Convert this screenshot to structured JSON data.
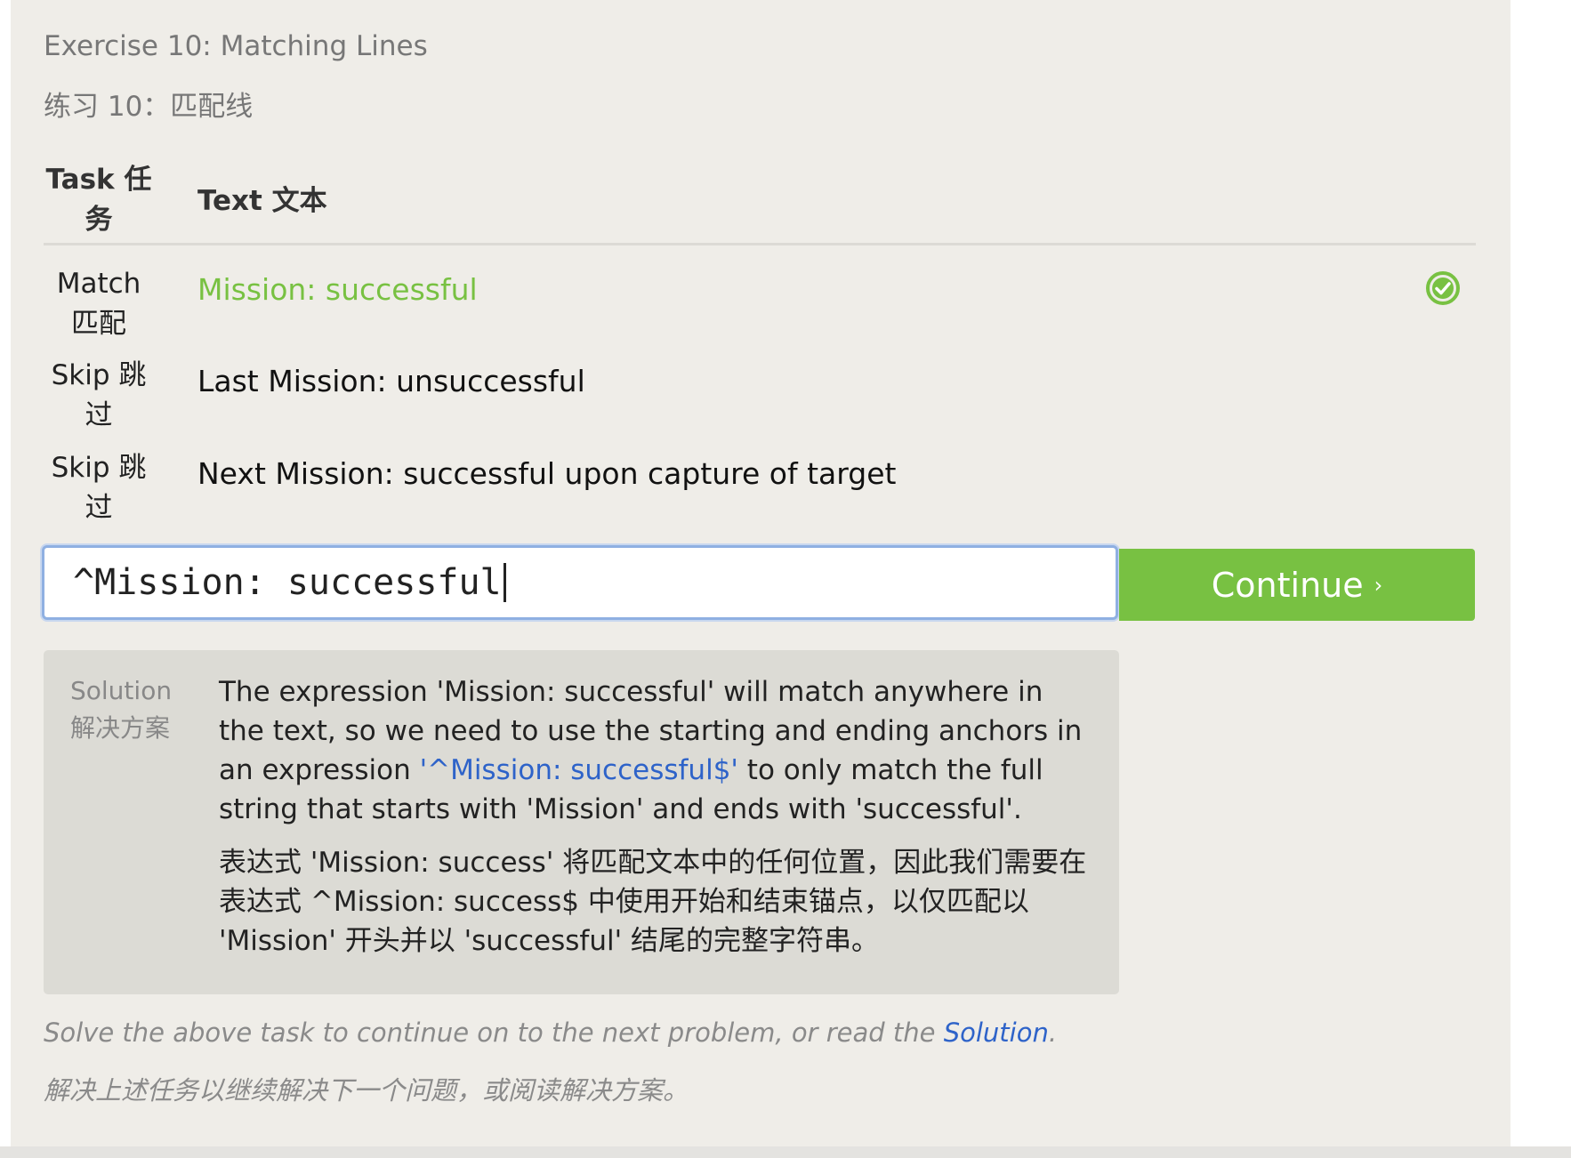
{
  "exercise": {
    "title_en": "Exercise 10: Matching Lines",
    "title_zh": "练习 10：匹配线"
  },
  "table": {
    "header_task": "Task 任务",
    "header_text": "Text 文本",
    "rows": [
      {
        "task": "Match 匹配",
        "text": "Mission: successful",
        "status": "matched"
      },
      {
        "task": "Skip 跳过",
        "text": "Last Mission: unsuccessful",
        "status": ""
      },
      {
        "task": "Skip 跳过",
        "text": "Next Mission: successful upon capture of target",
        "status": ""
      }
    ]
  },
  "input": {
    "value": "^Mission: successful"
  },
  "continue_button": {
    "label": "Continue",
    "chevron": "›"
  },
  "solution": {
    "label": "Solution 解决方案",
    "en_part1": "The expression 'Mission: successful' will match anywhere in the text, so we need to use the starting and ending anchors in an expression ",
    "en_highlight": "'^Mission: successful$'",
    "en_part2": " to only match the full string that starts with 'Mission' and ends with 'successful'.",
    "zh": "表达式 'Mission: success' 将匹配文本中的任何位置，因此我们需要在表达式 ^Mission: success$ 中使用开始和结束锚点，以仅匹配以 'Mission' 开头并以 'successful' 结尾的完整字符串。"
  },
  "footer": {
    "en_prefix": "Solve the above task to continue on to the next problem, or read the ",
    "en_link": "Solution",
    "en_suffix": ".",
    "zh": "解决上述任务以继续解决下一个问题，或阅读解决方案。"
  },
  "colors": {
    "accent_green": "#78c142",
    "link_blue": "#2e63c9"
  },
  "icons": {
    "match_status": "check-circle-icon"
  }
}
